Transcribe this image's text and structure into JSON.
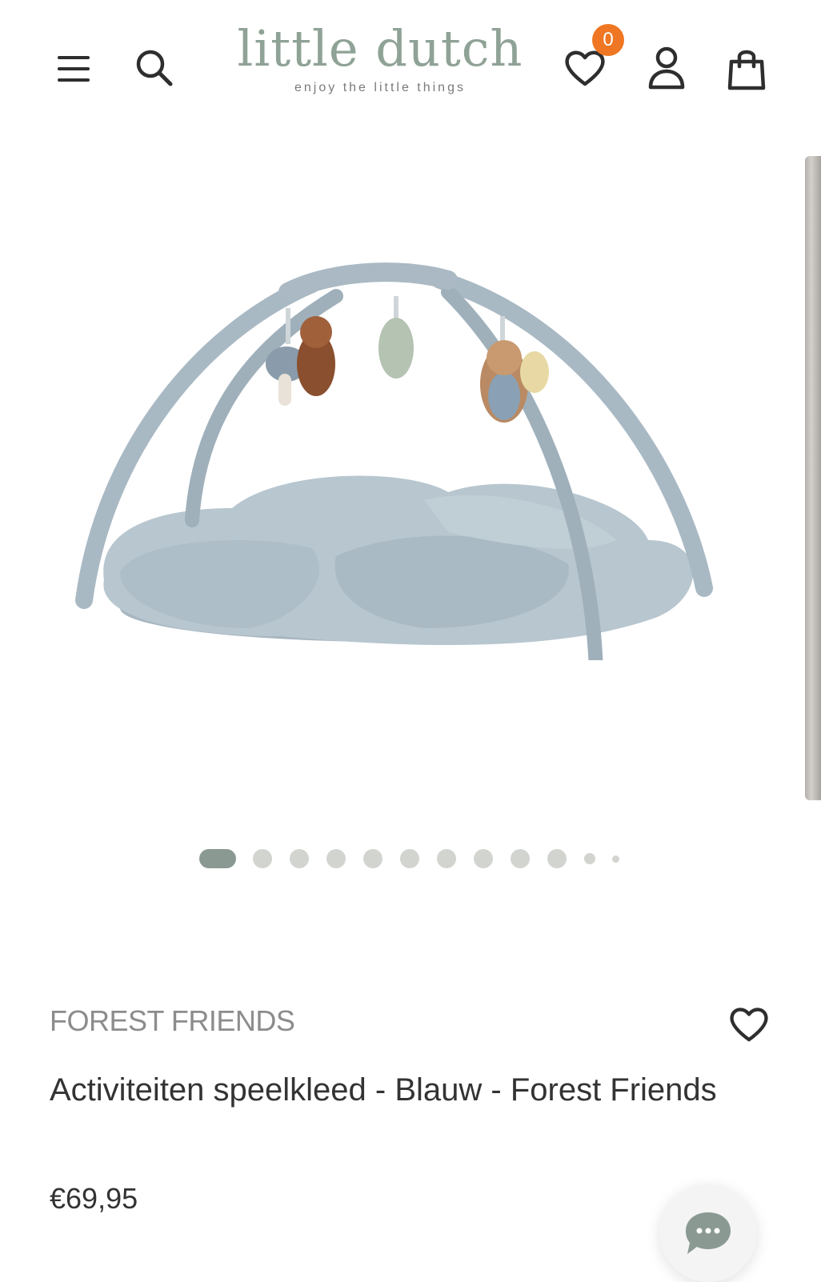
{
  "header": {
    "logo_title": "little dutch",
    "logo_tagline": "enjoy the little things",
    "wishlist_count": "0",
    "icons": [
      "menu-icon",
      "search-icon",
      "heart-icon",
      "account-icon",
      "shopping-bag-icon"
    ],
    "badge_color": "#ef7622"
  },
  "gallery": {
    "image_alt": "Activiteiten speelkleed - Blauw - Forest Friends",
    "active_index": 1,
    "dot_count": 12
  },
  "product": {
    "collection": "FOREST FRIENDS",
    "title": "Activiteiten speelkleed - Blauw - Forest Friends",
    "price": "€69,95"
  },
  "chat": {
    "icon": "chat-bubble-icon",
    "color": "#8a9a93"
  },
  "colors": {
    "brand": "#8fa296",
    "dot_active": "#8a9a93",
    "dot_inactive": "#d2d4d0",
    "text": "#333333",
    "collection_text": "#8c8c8c"
  }
}
